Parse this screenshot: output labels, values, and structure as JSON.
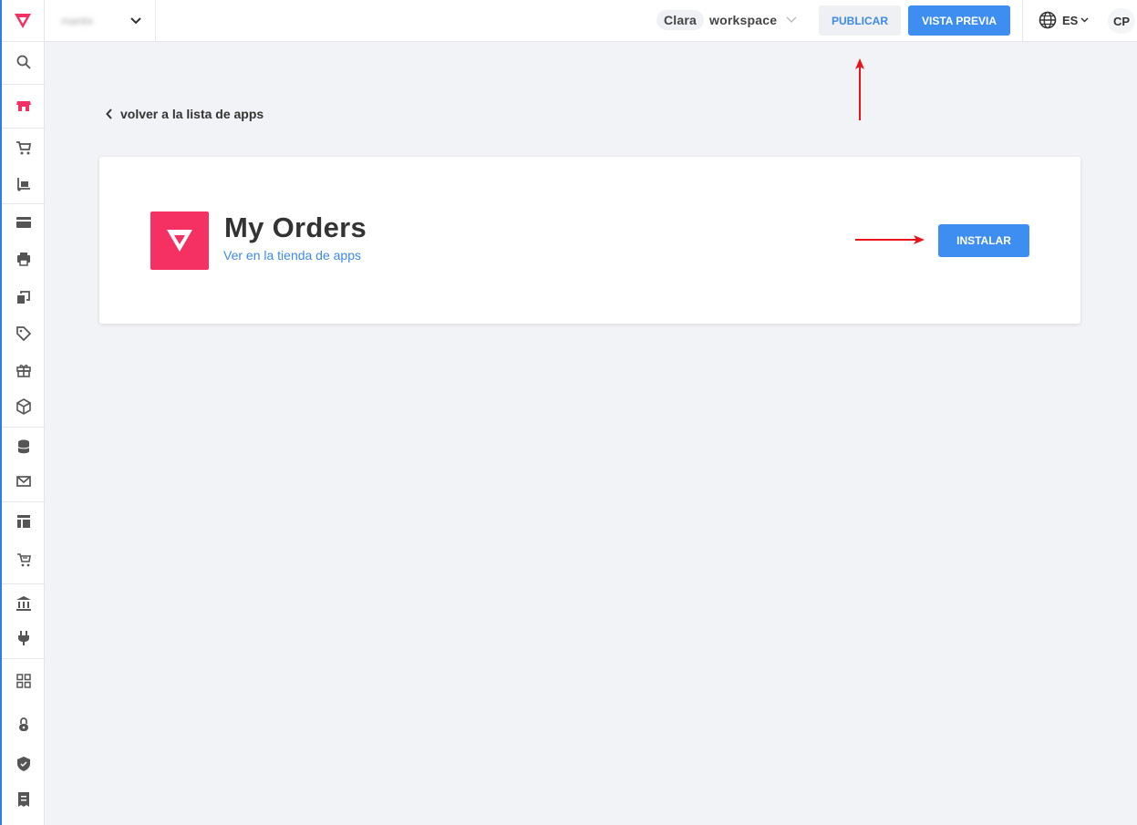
{
  "header": {
    "store_name": "mantix",
    "workspace_user": "Clara",
    "workspace_label": "workspace",
    "publish_label": "PUBLICAR",
    "preview_label": "VISTA PREVIA",
    "language": "ES",
    "avatar_initials": "CP"
  },
  "main": {
    "back_link": "volver a la lista de apps",
    "app_name": "My Orders",
    "app_store_link": "Ver en la tienda de apps",
    "install_label": "INSTALAR"
  },
  "sidebar": {
    "items": [
      "search-icon",
      "store-icon",
      "cart-icon",
      "dolly-icon",
      "card-icon",
      "printer-icon",
      "copy-icon",
      "tag-icon",
      "gift-icon",
      "box-icon",
      "database-icon",
      "mail-icon",
      "layout-icon",
      "cart-fast-icon",
      "bank-icon",
      "plug-icon",
      "apps-icon",
      "lock-icon",
      "shield-icon",
      "receipt-icon"
    ]
  },
  "colors": {
    "brand": "#f53063",
    "primary": "#3d8ef0",
    "link": "#3d8ae8",
    "annotation_arrow": "#e8141a"
  }
}
